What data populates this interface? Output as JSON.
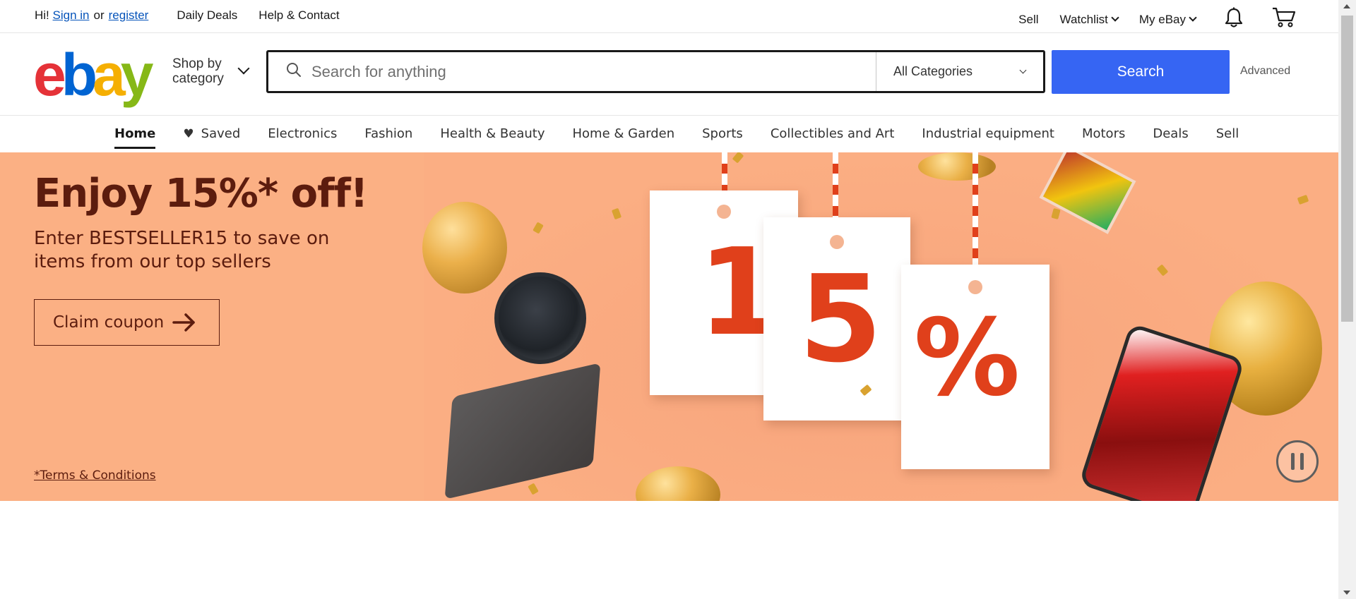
{
  "topbar": {
    "greeting": "Hi!",
    "sign_in": "Sign in",
    "or": "or",
    "register": "register",
    "daily_deals": "Daily Deals",
    "help_contact": "Help & Contact",
    "sell": "Sell",
    "watchlist": "Watchlist",
    "my_ebay": "My eBay",
    "icons": [
      "bell-icon",
      "cart-icon"
    ]
  },
  "header": {
    "logo": {
      "e": "e",
      "b": "b",
      "a": "a",
      "y": "y"
    },
    "shop_by_category": [
      "Shop by",
      "category"
    ],
    "search_placeholder": "Search for anything",
    "category_select": "All Categories",
    "search_button": "Search",
    "advanced": "Advanced"
  },
  "nav": {
    "items": [
      "Home",
      "Saved",
      "Electronics",
      "Fashion",
      "Health & Beauty",
      "Home & Garden",
      "Sports",
      "Collectibles and Art",
      "Industrial equipment",
      "Motors",
      "Deals",
      "Sell"
    ],
    "active": "Home"
  },
  "banner": {
    "headline": "Enjoy 15%* off!",
    "subtext": "Enter BESTSELLER15 to save on items from our top sellers",
    "cta": "Claim coupon",
    "terms": "*Terms & Conditions",
    "tag_glyphs": [
      "1",
      "5",
      "%"
    ],
    "colors": {
      "background": "#fbb084",
      "text": "#5c1c0e",
      "accent": "#e0401b"
    }
  },
  "colors": {
    "search_button": "#3665f3",
    "link": "#0654ba"
  }
}
